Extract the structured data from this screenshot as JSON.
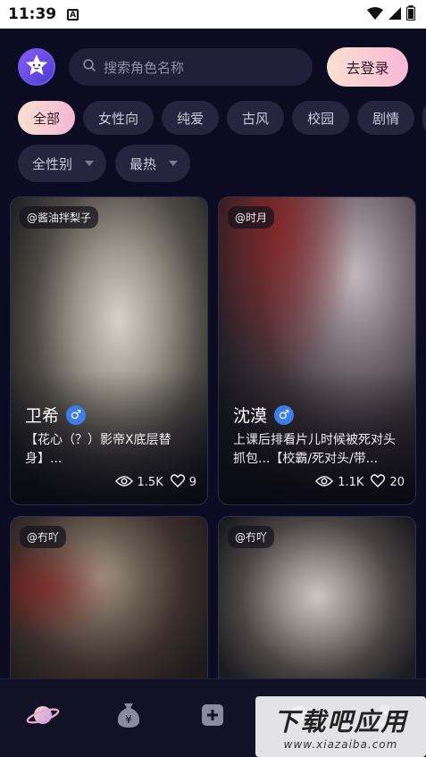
{
  "status_bar": {
    "time": "11:39",
    "notif_letter": "A"
  },
  "search": {
    "placeholder": "搜索角色名称"
  },
  "login_label": "去登录",
  "tags": [
    "全部",
    "女性向",
    "纯爱",
    "古风",
    "校园",
    "剧情"
  ],
  "filters": [
    "全性别",
    "最热"
  ],
  "cards": [
    {
      "author": "@酱油拌梨子",
      "name": "卫希",
      "gender": "♂",
      "desc": "【花心（？）影帝X底层替身】...",
      "views": "1.5K",
      "likes": "9"
    },
    {
      "author": "@时月",
      "name": "沈漠",
      "gender": "♂",
      "desc": "上课后排看片儿时候被死对头抓包...【校霸/死对头/带...",
      "views": "1.1K",
      "likes": "20"
    },
    {
      "author": "@冇吖"
    },
    {
      "author": "@冇吖"
    }
  ],
  "watermark": {
    "title": "下载吧应用",
    "url": "www.xiazaiba.com"
  },
  "colors": {
    "background": "#0b0b22",
    "accent_gradient_start": "#fbe0d0",
    "accent_gradient_end": "#f3b6d3",
    "male_badge": "#3d7de8"
  }
}
